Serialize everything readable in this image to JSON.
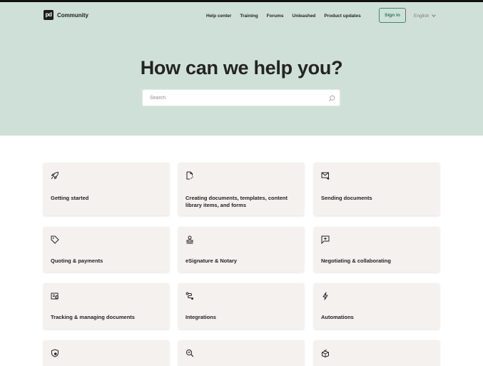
{
  "header": {
    "logo_mark": "pd",
    "logo_text": "Community",
    "nav": [
      "Help center",
      "Training",
      "Forums",
      "Unleashed",
      "Product updates"
    ],
    "sign_in": "Sign in",
    "language": "English"
  },
  "hero": {
    "title": "How can we help you?",
    "search_placeholder": "Search"
  },
  "categories": [
    {
      "label": "Getting started",
      "icon": "rocket-icon"
    },
    {
      "label": "Creating documents, templates, content library items, and forms",
      "icon": "document-edit-icon"
    },
    {
      "label": "Sending documents",
      "icon": "mail-send-icon"
    },
    {
      "label": "Quoting & payments",
      "icon": "tag-icon"
    },
    {
      "label": "eSignature & Notary",
      "icon": "stamp-icon"
    },
    {
      "label": "Negotiating & collaborating",
      "icon": "comment-plus-icon"
    },
    {
      "label": "Tracking & managing documents",
      "icon": "document-tracking-icon"
    },
    {
      "label": "Integrations",
      "icon": "integration-icon"
    },
    {
      "label": "Automations",
      "icon": "lightning-icon"
    },
    {
      "label": "",
      "icon": "shield-icon"
    },
    {
      "label": "",
      "icon": "search-analytics-icon"
    },
    {
      "label": "",
      "icon": "box-check-icon"
    }
  ],
  "colors": {
    "hero_background": "#cfe0d8",
    "card_background": "#f4f1ee",
    "accent": "#247a5c"
  }
}
